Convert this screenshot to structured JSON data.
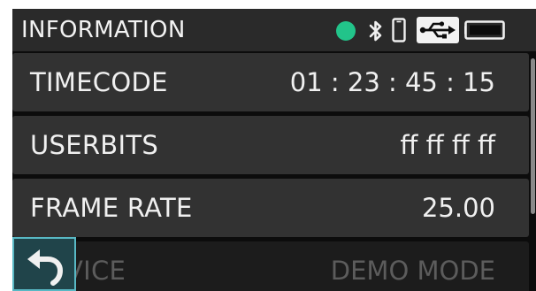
{
  "header": {
    "title": "INFORMATION",
    "icons": {
      "status_dot": "green-status-dot",
      "bluetooth": "bluetooth-icon",
      "phone": "phone-icon",
      "usb": "usb-icon",
      "battery": "battery-icon"
    }
  },
  "rows": [
    {
      "label": "TIMECODE",
      "value": "01 : 23 : 45 : 15"
    },
    {
      "label": "USERBITS",
      "value": "ff ff ff ff"
    },
    {
      "label": "FRAME RATE",
      "value": "25.00"
    },
    {
      "label": "VICE",
      "value": "DEMO MODE"
    }
  ],
  "back_button": {
    "icon": "back-arrow-icon"
  },
  "colors": {
    "status_green": "#22c48a",
    "accent_cyan": "#58b8c4",
    "header_bg": "#2a2a2a",
    "row_bg": "#323232"
  }
}
